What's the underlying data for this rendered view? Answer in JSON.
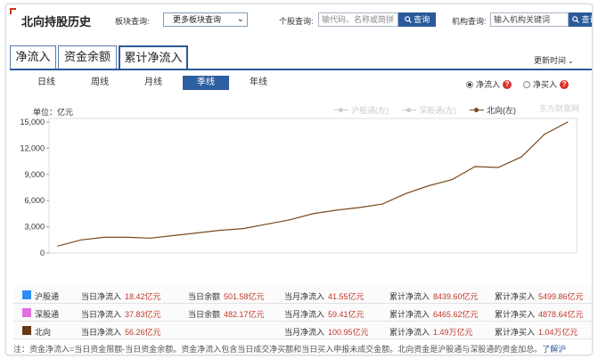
{
  "header": {
    "title": "北向持股历史",
    "board_label": "板块查询:",
    "board_select": "更多板块查询",
    "stock_label": "个股查询:",
    "stock_placeholder": "输代码、名称或简拼",
    "stock_button": "查询",
    "org_label": "机构查询:",
    "org_placeholder": "输入机构关键词",
    "org_button": "查询"
  },
  "tabs": [
    {
      "label": "净流入",
      "active": false
    },
    {
      "label": "资金余额",
      "active": false
    },
    {
      "label": "累计净流入",
      "active": true
    }
  ],
  "update_time": "更新时间",
  "periods": [
    {
      "label": "日线",
      "active": false
    },
    {
      "label": "周线",
      "active": false
    },
    {
      "label": "月线",
      "active": false
    },
    {
      "label": "季线",
      "active": true
    },
    {
      "label": "年线",
      "active": false
    }
  ],
  "net_options": [
    {
      "label": "净流入",
      "selected": true
    },
    {
      "label": "净买入",
      "selected": false
    }
  ],
  "watermark": "东方财富网",
  "chart_data": {
    "type": "line",
    "ylabel": "单位：亿元",
    "ylim": [
      0,
      15000
    ],
    "yticks": [
      "15,000",
      "12,000",
      "9,000",
      "6,000",
      "3,000",
      "0"
    ],
    "grid": false,
    "legend_position": "top-right",
    "legend": [
      {
        "name": "沪股通(左)",
        "color": "#cccccc",
        "active": false
      },
      {
        "name": "深股通(左)",
        "color": "#cccccc",
        "active": false
      },
      {
        "name": "北向(左)",
        "color": "#7a4a1e",
        "active": true
      }
    ],
    "series": [
      {
        "name": "北向(左)",
        "color": "#7a4a1e",
        "values": [
          800,
          1500,
          1800,
          1800,
          1700,
          2000,
          2300,
          2600,
          2800,
          3300,
          3800,
          4500,
          4900,
          5200,
          5600,
          6800,
          7700,
          8400,
          9900,
          9800,
          11000,
          13600,
          15000
        ]
      }
    ]
  },
  "table": {
    "rows": [
      {
        "name": "沪股通",
        "color": "#2d8ef5",
        "day_net_label": "当日净流入",
        "day_net": "18.42亿元",
        "day_bal_label": "当日余额",
        "day_bal": "501.58亿元",
        "month_net_label": "当月净流入",
        "month_net": "41.55亿元",
        "cum_net_label": "累计净流入",
        "cum_net": "8439.60亿元",
        "cum_buy_label": "累计净买入",
        "cum_buy": "5499.86亿元"
      },
      {
        "name": "深股通",
        "color": "#e36ee0",
        "day_net_label": "当日净流入",
        "day_net": "37.83亿元",
        "day_bal_label": "当日余额",
        "day_bal": "482.17亿元",
        "month_net_label": "当月净流入",
        "month_net": "59.41亿元",
        "cum_net_label": "累计净流入",
        "cum_net": "6465.62亿元",
        "cum_buy_label": "累计净买入",
        "cum_buy": "4878.64亿元"
      },
      {
        "name": "北向",
        "color": "#6a3a12",
        "day_net_label": "当日净流入",
        "day_net": "56.26亿元",
        "day_bal_label": "",
        "day_bal": "",
        "month_net_label": "当月净流入",
        "month_net": "100.95亿元",
        "cum_net_label": "累计净流入",
        "cum_net": "1.49万亿元",
        "cum_buy_label": "累计净买入",
        "cum_buy": "1.04万亿元"
      }
    ]
  },
  "note": {
    "text": "注：资金净流入=当日资金限额-当日资金余额。资金净流入包含当日成交净买额和当日买入申报未成交金额。北向资金是沪股通与深股通的资金加总。",
    "link": "了解沪"
  }
}
